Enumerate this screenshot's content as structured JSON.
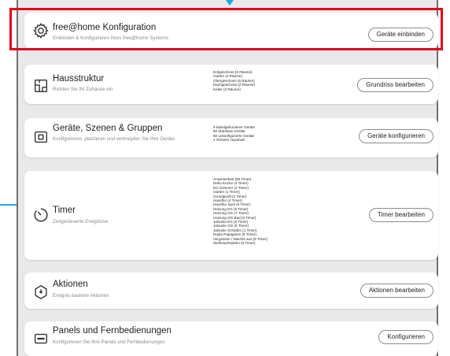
{
  "cards": [
    {
      "title": "free@home Konfiguration",
      "subtitle": "Einbinden & Konfigurieren Ihres free@home Systems",
      "button": "Geräte einbinden",
      "icon": "gear-icon",
      "details": []
    },
    {
      "title": "Hausstruktur",
      "subtitle": "Richten Sie Ihr Zuhause ein",
      "button": "Grundriss bearbeiten",
      "icon": "floorplan-icon",
      "details": [
        "Erdgeschoss (6 Räume)",
        "Garten (3 Räume)",
        "Obergeschoss (6 Räume)",
        "Dachgeschoss (2 Räume)",
        "Keller (3 Räume)"
      ]
    },
    {
      "title": "Geräte, Szenen & Gruppen",
      "subtitle": "Konfigurieren, platzieren und verknüpfen Sie Ihre Geräte",
      "button": "Geräte konfigurieren",
      "icon": "device-icon",
      "details": [
        "9 kabelgebundene Geräte",
        "60 drahtlose Geräte",
        "60 unkonfigurierte Geräte",
        "1 SONOS Haushalt"
      ]
    },
    {
      "title": "Timer",
      "subtitle": "Zeitgesteuerte Ereignisse",
      "button": "Timer bearbeiten",
      "icon": "timer-icon",
      "details": [
        "Anwesenheit (80 Timer)",
        "Deko Küche (4 Timer)",
        "EG Sommer (2 Timer)",
        "Garten (1 Timer)",
        "Grundprofil (3 Timer)",
        "Hausflur (4 Timer)",
        "Hausflur Spot (6 Timer)",
        "Heizung EG (5 Timer)",
        "Heizung OG (7 Timer)",
        "Heizung OG Bad (6 Timer)",
        "Jalousie EG (6 Timer)",
        "Jalousie OG (6 Timer)",
        "Jalousie Schlafen (1 Timer)",
        "Radio Papageien (5 Timer)",
        "Vergessen / Wachts aus (9 Timer)",
        "Weihnachtsdeko (6 Timer)"
      ]
    },
    {
      "title": "Aktionen",
      "subtitle": "Ereignis basierte Aktionen",
      "button": "Aktionen bearbeiten",
      "icon": "action-icon",
      "details": []
    },
    {
      "title": "Panels und Fernbedienungen",
      "subtitle": "Konfigurieren Sie Ihre Panels und Fernbedienungen",
      "button": "Konfigurieren",
      "icon": "panel-icon",
      "details": []
    }
  ],
  "colors": {
    "highlight": "#e3001b",
    "pointer": "#22a7e0",
    "background": "#e9e9e9"
  }
}
